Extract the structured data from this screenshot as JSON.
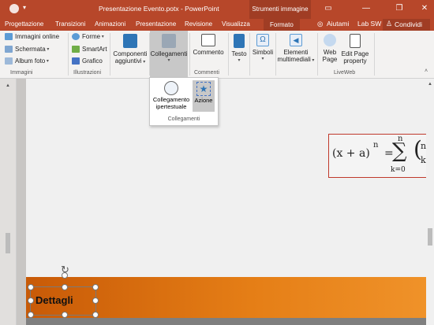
{
  "app": {
    "title": "Presentazione Evento.potx  -  PowerPoint",
    "context_group": "Strumenti immagine",
    "window_controls": [
      "restore-down-icon",
      "minimize-icon",
      "maximize-icon",
      "close-icon"
    ]
  },
  "tabs": [
    "Progettazione",
    "Transizioni",
    "Animazioni",
    "Presentazione",
    "Revisione",
    "Visualizza",
    "Formato"
  ],
  "tell_me": "Aiutami",
  "user": "Lab SW",
  "share": "Condividi",
  "ribbon": {
    "immagini": {
      "label": "Immagini",
      "items": [
        "Immagini online",
        "Schermata",
        "Album foto"
      ]
    },
    "illustrazioni": {
      "label": "Illustrazioni",
      "items": [
        "Forme",
        "SmartArt",
        "Grafico"
      ]
    },
    "componenti": {
      "line1": "Componenti",
      "line2": "aggiuntivi"
    },
    "collegamenti": {
      "label": "Collegamenti"
    },
    "commenti": {
      "label": "Commenti",
      "commento": "Commento"
    },
    "testo": "Testo",
    "simboli": "Simboli",
    "elementi": {
      "line1": "Elementi",
      "line2": "multimediali"
    },
    "webpage": {
      "line1": "Web",
      "line2": "Page"
    },
    "editpage": {
      "line1": "Edit Page",
      "line2": "property"
    },
    "liveweb_label": "LiveWeb"
  },
  "dropdown": {
    "link": {
      "line1": "Collegamento",
      "line2": "ipertestuale"
    },
    "action": "Azione",
    "group_label": "Collegamenti"
  },
  "slide": {
    "title_text": "Dettagli",
    "formula": {
      "lhs": "(x + a)",
      "exp": "n",
      "eq": "=",
      "sigma": "∑",
      "upper": "n",
      "lower": "k=0",
      "paren": "(",
      "right_top": "n",
      "right_bottom": "k"
    }
  },
  "colors": {
    "accent": "#b7472a",
    "band": "#e57e16"
  }
}
